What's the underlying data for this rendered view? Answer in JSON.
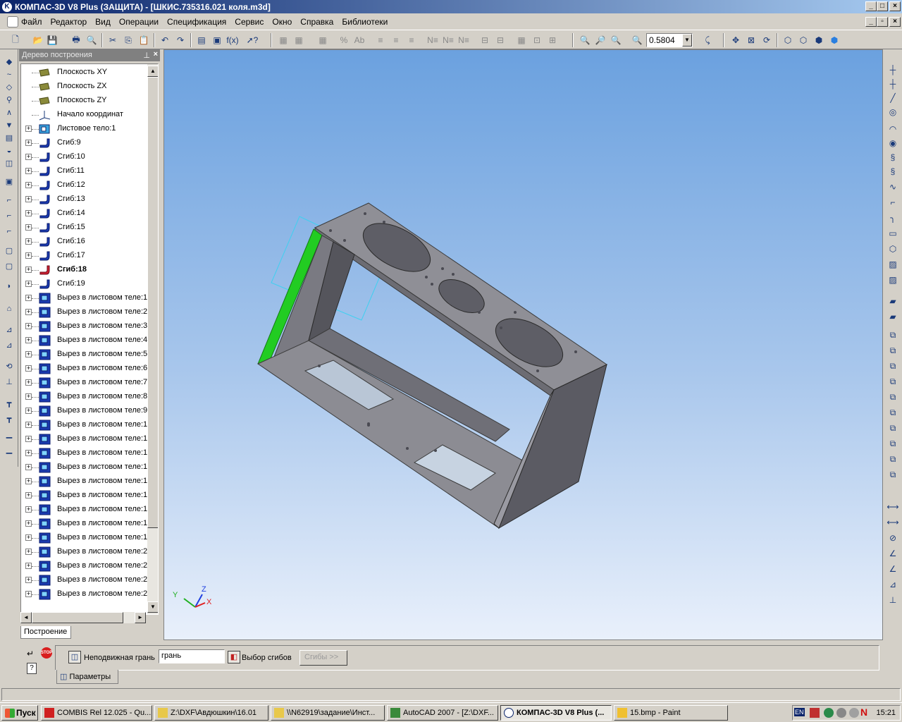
{
  "window": {
    "title": "КОМПАС-3D V8 Plus (ЗАЩИТА) - [ШКИС.735316.021 коля.m3d]",
    "controls": [
      "_",
      "□",
      "×"
    ],
    "mdi_controls": [
      "_",
      "▫",
      "×"
    ]
  },
  "menu": [
    "Файл",
    "Редактор",
    "Вид",
    "Операции",
    "Спецификация",
    "Сервис",
    "Окно",
    "Справка",
    "Библиотеки"
  ],
  "toolbar": {
    "zoom_value": "0.5804",
    "button_icons": [
      "new-icon",
      "open-icon",
      "save-icon",
      "print-preview-icon",
      "cut-icon",
      "copy-icon",
      "paste-icon",
      "undo-icon",
      "redo-icon",
      "manager-icon",
      "variables-icon",
      "fx-icon",
      "help-pointer-icon",
      "filter-icon",
      "zoom-in-icon",
      "zoom-window-icon",
      "zoom-out-icon",
      "zoom-scale-icon",
      "orientation-icon",
      "pan-icon",
      "fit-icon",
      "rotate-icon",
      "wireframe-icon",
      "hidden-lines-icon",
      "shaded-icon",
      "shaded-edges-icon"
    ]
  },
  "tree": {
    "header": "Дерево построения",
    "tab": "Построение",
    "items": [
      {
        "label": "Плоскость XY",
        "icon": "plane-icon",
        "expand": false,
        "bold": false
      },
      {
        "label": "Плоскость ZX",
        "icon": "plane-icon",
        "expand": false,
        "bold": false
      },
      {
        "label": "Плоскость ZY",
        "icon": "plane-icon",
        "expand": false,
        "bold": false
      },
      {
        "label": "Начало координат",
        "icon": "origin-icon",
        "expand": false,
        "bold": false
      },
      {
        "label": "Листовое тело:1",
        "icon": "sheet-body-icon",
        "expand": true,
        "bold": false
      },
      {
        "label": "Сгиб:9",
        "icon": "bend-icon",
        "expand": true,
        "bold": false
      },
      {
        "label": "Сгиб:10",
        "icon": "bend-icon",
        "expand": true,
        "bold": false
      },
      {
        "label": "Сгиб:11",
        "icon": "bend-icon",
        "expand": true,
        "bold": false
      },
      {
        "label": "Сгиб:12",
        "icon": "bend-icon",
        "expand": true,
        "bold": false
      },
      {
        "label": "Сгиб:13",
        "icon": "bend-icon",
        "expand": true,
        "bold": false
      },
      {
        "label": "Сгиб:14",
        "icon": "bend-icon",
        "expand": true,
        "bold": false
      },
      {
        "label": "Сгиб:15",
        "icon": "bend-icon",
        "expand": true,
        "bold": false
      },
      {
        "label": "Сгиб:16",
        "icon": "bend-icon",
        "expand": true,
        "bold": false
      },
      {
        "label": "Сгиб:17",
        "icon": "bend-icon",
        "expand": true,
        "bold": false
      },
      {
        "label": "Сгиб:18",
        "icon": "bend-active-icon",
        "expand": true,
        "bold": true
      },
      {
        "label": "Сгиб:19",
        "icon": "bend-icon",
        "expand": true,
        "bold": false
      },
      {
        "label": "Вырез в листовом теле:1",
        "icon": "cut-icon",
        "expand": true,
        "bold": false
      },
      {
        "label": "Вырез в листовом теле:2",
        "icon": "cut-icon",
        "expand": true,
        "bold": false
      },
      {
        "label": "Вырез в листовом теле:3",
        "icon": "cut-icon",
        "expand": true,
        "bold": false
      },
      {
        "label": "Вырез в листовом теле:4",
        "icon": "cut-icon",
        "expand": true,
        "bold": false
      },
      {
        "label": "Вырез в листовом теле:5",
        "icon": "cut-icon",
        "expand": true,
        "bold": false
      },
      {
        "label": "Вырез в листовом теле:6",
        "icon": "cut-icon",
        "expand": true,
        "bold": false
      },
      {
        "label": "Вырез в листовом теле:7",
        "icon": "cut-icon",
        "expand": true,
        "bold": false
      },
      {
        "label": "Вырез в листовом теле:8",
        "icon": "cut-icon",
        "expand": true,
        "bold": false
      },
      {
        "label": "Вырез в листовом теле:9",
        "icon": "cut-icon",
        "expand": true,
        "bold": false
      },
      {
        "label": "Вырез в листовом теле:1",
        "icon": "cut-icon",
        "expand": true,
        "bold": false
      },
      {
        "label": "Вырез в листовом теле:1",
        "icon": "cut-icon",
        "expand": true,
        "bold": false
      },
      {
        "label": "Вырез в листовом теле:1",
        "icon": "cut-icon",
        "expand": true,
        "bold": false
      },
      {
        "label": "Вырез в листовом теле:1",
        "icon": "cut-icon",
        "expand": true,
        "bold": false
      },
      {
        "label": "Вырез в листовом теле:1",
        "icon": "cut-icon",
        "expand": true,
        "bold": false
      },
      {
        "label": "Вырез в листовом теле:1",
        "icon": "cut-icon",
        "expand": true,
        "bold": false
      },
      {
        "label": "Вырез в листовом теле:1",
        "icon": "cut-icon",
        "expand": true,
        "bold": false
      },
      {
        "label": "Вырез в листовом теле:1",
        "icon": "cut-icon",
        "expand": true,
        "bold": false
      },
      {
        "label": "Вырез в листовом теле:1",
        "icon": "cut-icon",
        "expand": true,
        "bold": false
      },
      {
        "label": "Вырез в листовом теле:2",
        "icon": "cut-icon",
        "expand": true,
        "bold": false
      },
      {
        "label": "Вырез в листовом теле:2",
        "icon": "cut-icon",
        "expand": true,
        "bold": false
      },
      {
        "label": "Вырез в листовом теле:2",
        "icon": "cut-icon",
        "expand": true,
        "bold": false
      },
      {
        "label": "Вырез в листовом теле:2",
        "icon": "cut-icon",
        "expand": true,
        "bold": false
      }
    ]
  },
  "viewport": {
    "axis_labels": {
      "x": "X",
      "y": "Y",
      "z": "Z"
    },
    "colors": {
      "selected_face": "#22cc22",
      "model": "#8e8e94",
      "axis_x": "#e02020",
      "axis_y": "#20b020",
      "axis_z": "#2040e0"
    }
  },
  "properties": {
    "fixed_face_label": "Неподвижная грань",
    "fixed_face_value": "грань",
    "bends_select_label": "Выбор сгибов",
    "bends_button": "Сгибы  >>",
    "tab": "Параметры"
  },
  "taskbar": {
    "start": "Пуск",
    "tasks": [
      {
        "label": "COMBIS Rel 12.025 - Qu...",
        "icon": "combis-icon",
        "active": false
      },
      {
        "label": "Z:\\DXF\\Авдюшкин\\16.01",
        "icon": "folder-icon",
        "active": false
      },
      {
        "label": "\\\\N62919\\задание\\Инст...",
        "icon": "folder-icon",
        "active": false
      },
      {
        "label": "AutoCAD 2007 - [Z:\\DXF...",
        "icon": "autocad-icon",
        "active": false
      },
      {
        "label": "КОМПАС-3D V8 Plus (...",
        "icon": "kompas-icon",
        "active": true
      },
      {
        "label": "15.bmp - Paint",
        "icon": "paint-icon",
        "active": false
      }
    ],
    "lang": "EN",
    "clock": "15:21"
  }
}
